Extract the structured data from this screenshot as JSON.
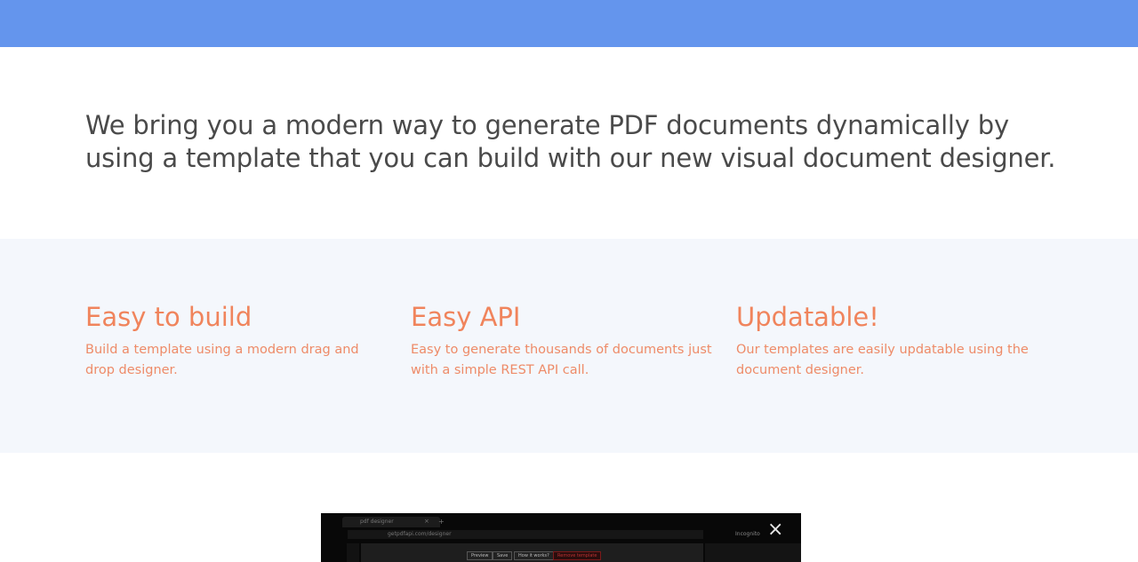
{
  "hero": {
    "text": "We bring you a modern way to generate PDF documents dynamically by using a template that you can build with our new visual document designer."
  },
  "features": [
    {
      "title": "Easy to build",
      "description": "Build a template using a modern drag and drop designer."
    },
    {
      "title": "Easy API",
      "description": "Easy to generate thousands of documents just with a simple REST API call."
    },
    {
      "title": "Updatable!",
      "description": "Our templates are easily updatable using the document designer."
    }
  ],
  "video": {
    "tab_title": "pdf designer",
    "address": "getpdfapi.com/designer",
    "profile": "Incognito",
    "buttons": [
      "Preview",
      "Save",
      "How it works?",
      "Remove template"
    ],
    "close_symbol": "×"
  }
}
